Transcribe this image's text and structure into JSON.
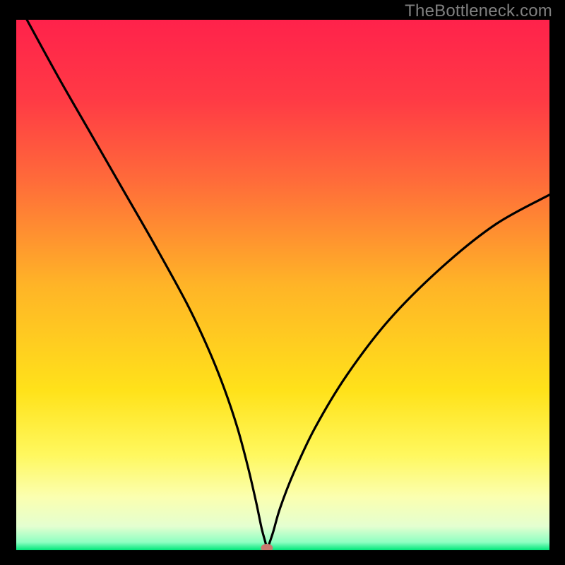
{
  "watermark": "TheBottleneck.com",
  "chart_data": {
    "type": "line",
    "title": "",
    "xlabel": "",
    "ylabel": "",
    "xlim": [
      0,
      100
    ],
    "ylim": [
      0,
      100
    ],
    "background_gradient_stops": [
      {
        "offset": 0.0,
        "color": "#ff224b"
      },
      {
        "offset": 0.15,
        "color": "#ff3a45"
      },
      {
        "offset": 0.3,
        "color": "#ff6a3a"
      },
      {
        "offset": 0.5,
        "color": "#ffb427"
      },
      {
        "offset": 0.7,
        "color": "#ffe21a"
      },
      {
        "offset": 0.82,
        "color": "#fff85e"
      },
      {
        "offset": 0.9,
        "color": "#fbffb0"
      },
      {
        "offset": 0.955,
        "color": "#e4ffd0"
      },
      {
        "offset": 0.985,
        "color": "#8effc2"
      },
      {
        "offset": 1.0,
        "color": "#00e67a"
      }
    ],
    "curve": {
      "x": [
        2.0,
        8.0,
        14.0,
        20.0,
        26.0,
        32.0,
        36.0,
        39.0,
        41.5,
        43.5,
        45.0,
        46.0,
        46.8,
        47.0,
        47.3,
        48.2,
        49.5,
        52.0,
        56.0,
        62.0,
        70.0,
        80.0,
        90.0,
        100.0
      ],
      "y": [
        100.0,
        89.0,
        78.5,
        68.0,
        57.5,
        46.5,
        38.0,
        30.5,
        23.0,
        15.5,
        9.0,
        4.2,
        1.2,
        0.0,
        0.8,
        3.5,
        8.0,
        14.5,
        23.0,
        33.0,
        43.5,
        53.5,
        61.5,
        67.0
      ]
    },
    "marker": {
      "x": 47.0,
      "y": 0.0,
      "color": "#c97a6f"
    }
  }
}
